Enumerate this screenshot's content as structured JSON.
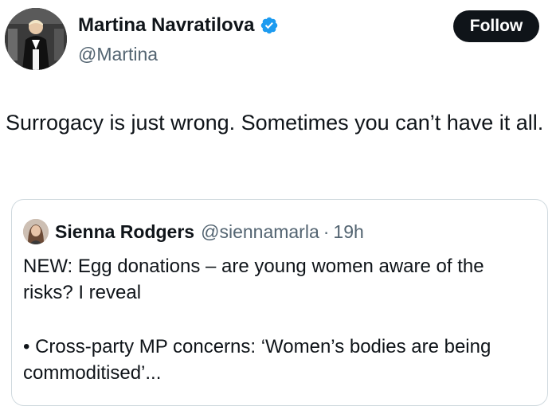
{
  "author": {
    "name": "Martina Navratilova",
    "handle": "@Martina",
    "verified": true
  },
  "follow_button": {
    "label": "Follow"
  },
  "tweet": {
    "text": "Surrogacy is just wrong. Sometimes you can’t have it all."
  },
  "quoted_tweet": {
    "author_name": "Sienna Rodgers",
    "handle": "@siennamarla",
    "separator": "·",
    "time": "19h",
    "text": "NEW: Egg donations – are young women aware of the risks? I reveal",
    "bullet": "• Cross-party MP concerns: ‘Women’s bodies are being commoditised’..."
  },
  "colors": {
    "verified_blue": "#1d9bf0",
    "text_primary": "#0f1419",
    "text_secondary": "#536471",
    "border": "#cfd9de"
  },
  "icons": {
    "verified": "verified-badge-icon"
  }
}
